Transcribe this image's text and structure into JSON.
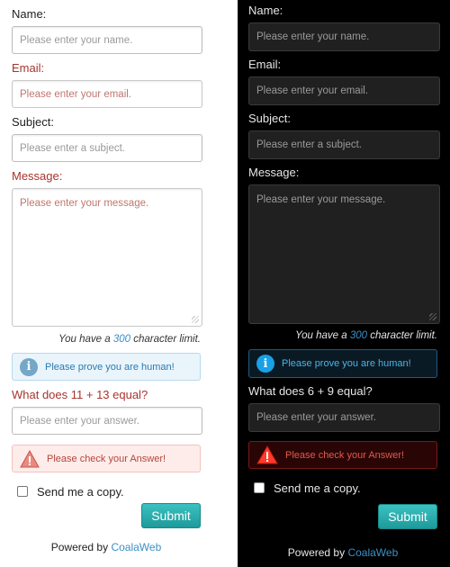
{
  "light": {
    "name_label": "Name:",
    "name_placeholder": "Please enter your name.",
    "email_label": "Email:",
    "email_placeholder": "Please enter your email.",
    "subject_label": "Subject:",
    "subject_placeholder": "Please enter a subject.",
    "message_label": "Message:",
    "message_placeholder": "Please enter your message.",
    "char_limit_prefix": "You have a",
    "char_limit_value": "300",
    "char_limit_suffix": "character limit.",
    "human_notice": "Please prove you are human!",
    "question": "What does 11 + 13 equal?",
    "answer_placeholder": "Please enter your answer.",
    "answer_error": "Please check your Answer!",
    "copy_label": "Send me a copy.",
    "submit_label": "Submit",
    "powered_prefix": "Powered by",
    "powered_brand": "CoalaWeb"
  },
  "dark": {
    "name_label": "Name:",
    "name_placeholder": "Please enter your name.",
    "email_label": "Email:",
    "email_placeholder": "Please enter your email.",
    "subject_label": "Subject:",
    "subject_placeholder": "Please enter a subject.",
    "message_label": "Message:",
    "message_placeholder": "Please enter your message.",
    "char_limit_prefix": "You have a",
    "char_limit_value": "300",
    "char_limit_suffix": "character limit.",
    "human_notice": "Please prove you are human!",
    "question": "What does 6 + 9 equal?",
    "answer_placeholder": "Please enter your answer.",
    "answer_error": "Please check your Answer!",
    "copy_label": "Send me a copy.",
    "submit_label": "Submit",
    "powered_prefix": "Powered by",
    "powered_brand": "CoalaWeb"
  },
  "colors": {
    "accent_link": "#3a8fc8",
    "submit": "#2aa9aa",
    "error_label": "#a8332d",
    "dark_bg": "#000000"
  }
}
